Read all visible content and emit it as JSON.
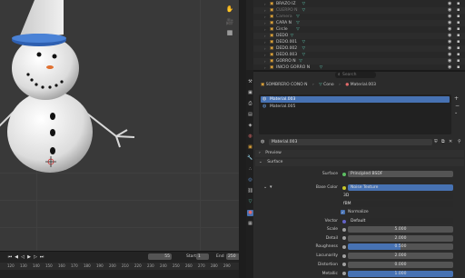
{
  "outliner": {
    "rows": [
      {
        "label": "BRAZO IZ",
        "dim": false
      },
      {
        "label": "CUERPO N",
        "dim": true
      },
      {
        "label": "Camera",
        "dim": true
      },
      {
        "label": "CARA N",
        "dim": false
      },
      {
        "label": "Circle",
        "dim": false
      },
      {
        "label": "DEDO",
        "dim": false
      },
      {
        "label": "DEDO.001",
        "dim": false
      },
      {
        "label": "DEDO.002",
        "dim": false
      },
      {
        "label": "DEDO.003",
        "dim": false
      },
      {
        "label": "GORRO N",
        "dim": false
      },
      {
        "label": "INICIO GORRO N",
        "dim": false
      }
    ]
  },
  "properties": {
    "breadcrumb_object": "SOMBRERO CONO N",
    "breadcrumb_mesh": "Cono",
    "breadcrumb_material": "Material.003",
    "slots": [
      "Material.003",
      "Material.005"
    ],
    "material_name": "Material.003",
    "section_preview": "Preview",
    "section_surface": "Surface",
    "surface_label": "Surface",
    "surface_value": "Principled BSDF",
    "base_color_label": "Base Color",
    "base_color_value": "Noise Texture",
    "dim_value": "3D",
    "mode_value": "fBM",
    "normalize_label": "Normalize",
    "vector_label": "Vector",
    "vector_value": "Default",
    "params": [
      {
        "label": "Scale",
        "value": "5.000",
        "fill": 0
      },
      {
        "label": "Detail",
        "value": "2.000",
        "fill": 0
      },
      {
        "label": "Roughness",
        "value": "0.500",
        "fill": 0.5
      },
      {
        "label": "Lacunarity",
        "value": "2.000",
        "fill": 0
      },
      {
        "label": "Distortion",
        "value": "0.000",
        "fill": 0
      },
      {
        "label": "Metallic",
        "value": "1.000",
        "fill": 1
      }
    ],
    "search_placeholder": "Search"
  },
  "timeline": {
    "current_frame": "55",
    "start_label": "Start",
    "start_value": "1",
    "end_label": "End",
    "end_value": "250",
    "ticks": [
      "120",
      "130",
      "140",
      "150",
      "160",
      "170",
      "180",
      "190",
      "200",
      "210",
      "220",
      "230",
      "240",
      "250",
      "260",
      "270",
      "280",
      "290"
    ]
  },
  "colors": {
    "accent": "#4772b3",
    "outliner_tri": "#5ec9b0"
  }
}
